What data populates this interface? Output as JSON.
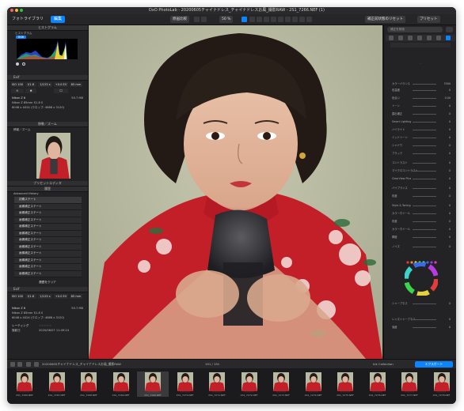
{
  "window": {
    "title": "DxO PhotoLab - 20200605チャイナドレス_チャイナドレスお風_撮影RAW - 2S1_7266.NEF (1)",
    "tabs": [
      "フォトライブラリ",
      "編集"
    ],
    "compare_label": "比較",
    "original_label": "原画比較",
    "zoom": "50 %",
    "reset_label": "補正前状態のリセット",
    "presets_label": "プリセット"
  },
  "left_panel": {
    "histogram_header": "ヒストグラム",
    "histogram_sub": "ヒストグラム",
    "histogram_channel": "RGB",
    "exif_header": "Exif",
    "exif_values": [
      "ISO 100",
      "f/1.8",
      "1/125 s",
      "+0.0 EV",
      "85 mm"
    ],
    "camera": "Nikon Z 6",
    "lens_size": "50.7 MB",
    "lens": "Nikon Z 85mm f/1.8 S",
    "dims": "6048 x 4024 (クロップ: 4688 x 3120)",
    "navigator_header": "移動／ズーム",
    "navigator_sub": "移動／ズーム",
    "preset_header": "プリセットエディタ",
    "history_header": "履歴",
    "history_sub": "Advanced History",
    "history_items": [
      "初期ステート",
      "画像補正ステート",
      "画像補正ステート",
      "画像補正ステート",
      "画像補正ステート",
      "画像補正ステート",
      "画像補正ステート",
      "画像補正ステート",
      "画像補正ステート",
      "画像補正ステート",
      "画像補正ステート",
      "画像補正ステート"
    ],
    "history_clear": "履歴をクリア",
    "exif2_header": "Exif",
    "rating_label": "レーティング",
    "date_label": "撮影日",
    "date": "2020/06/07 11:49:24"
  },
  "right_panel": {
    "search_placeholder": "補正を検索",
    "rows": [
      "カラーバランス",
      "色温度",
      "色合い",
      "トーン",
      "露出補正",
      "Smart Lighting",
      "ハイライト",
      "ミッドトーン",
      "シャドウ",
      "ブラック",
      "コントラスト",
      "マイクロコントラスト",
      "ClearView Plus",
      "バイブランス",
      "彩度",
      "Style & Toning",
      "カラーホイール",
      "彩度",
      "カラーホイール",
      "輝度",
      "ノイズ",
      "シャープネス",
      "レンズシャープネス",
      "強度"
    ],
    "values": [
      "5500",
      "0",
      "0.00",
      "0",
      "0",
      "0",
      "0",
      "0",
      "0",
      "0",
      "0",
      "0",
      "0",
      "0",
      "0",
      "0",
      "0",
      "0",
      "0",
      "0",
      "0",
      "0",
      "0",
      "0"
    ]
  },
  "filmstrip": {
    "folder": "20200605チャイナドレス_チャイナドレスお風_撮影RAW",
    "count": "191 / 191",
    "collection_label": "Ink Collection",
    "export_label": "エクスポート",
    "captions": [
      "2S1_7266.NEF",
      "2S1_7267.NEF",
      "2S1_7268.NEF",
      "2S1_7269.NEF",
      "2S1_7266.NEF",
      "2S1_7270.NEF",
      "2S1_7271.NEF",
      "2S1_7272.NEF",
      "2S1_7273.NEF",
      "2S1_7274.NEF",
      "2S1_7275.NEF",
      "2S1_7276.NEF",
      "2S1_7277.NEF",
      "2S1_7278.NEF"
    ],
    "stars": "☆☆☆☆☆"
  },
  "colors": {
    "panel": "#232325",
    "accent": "#0a84ff",
    "dress": "#c7202a"
  }
}
